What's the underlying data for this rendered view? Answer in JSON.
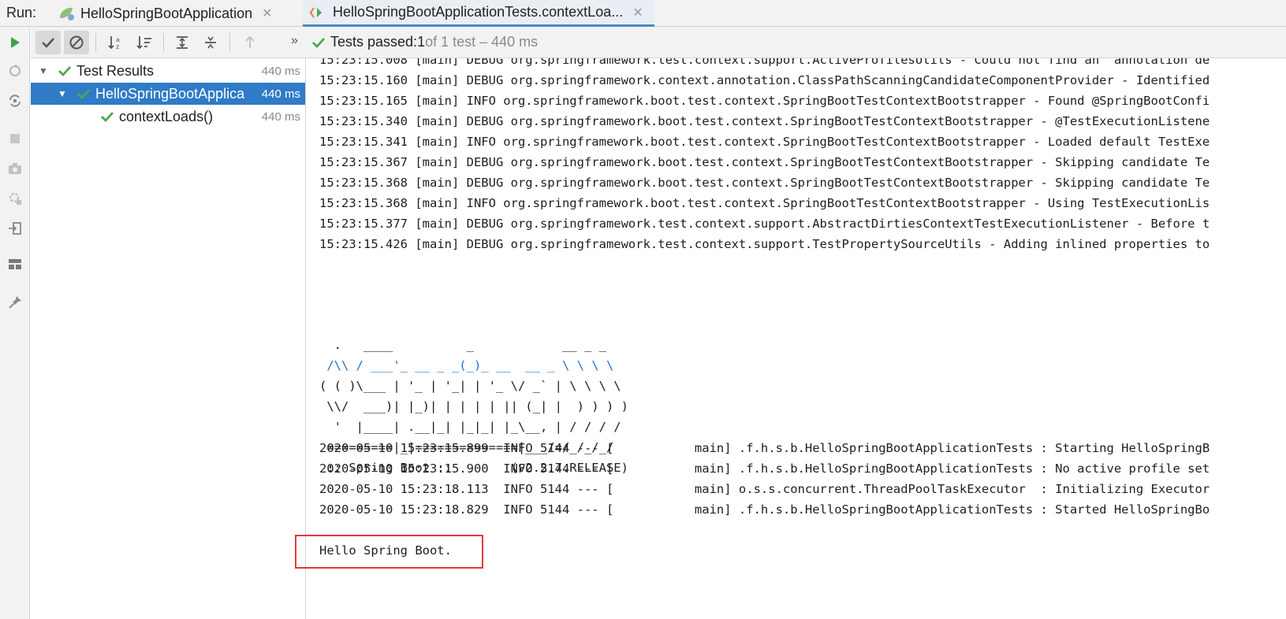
{
  "tabbar": {
    "run_label": "Run:",
    "tabs": [
      {
        "label": "HelloSpringBootApplication",
        "icon": "spring-app-icon"
      },
      {
        "label": "HelloSpringBootApplicationTests.contextLoa...",
        "icon": "test-run-icon"
      }
    ]
  },
  "toolbar": {
    "chevron": "»",
    "status_prefix": "Tests passed: ",
    "status_count": "1",
    "status_suffix": " of 1 test – 440 ms"
  },
  "tree": {
    "rows": [
      {
        "label": "Test Results",
        "duration": "440 ms"
      },
      {
        "label": "HelloSpringBootApplica",
        "duration": "440 ms"
      },
      {
        "label": "contextLoads()",
        "duration": "440 ms"
      }
    ]
  },
  "console": {
    "log_lines": [
      "15:23:15.008 [main] DEBUG org.springframework.test.context.support.ActiveProfilesUtils - Could not find an 'annotation de",
      "15:23:15.160 [main] DEBUG org.springframework.context.annotation.ClassPathScanningCandidateComponentProvider - Identified",
      "15:23:15.165 [main] INFO org.springframework.boot.test.context.SpringBootTestContextBootstrapper - Found @SpringBootConfi",
      "15:23:15.340 [main] DEBUG org.springframework.boot.test.context.SpringBootTestContextBootstrapper - @TestExecutionListene",
      "15:23:15.341 [main] INFO org.springframework.boot.test.context.SpringBootTestContextBootstrapper - Loaded default TestExe",
      "15:23:15.367 [main] DEBUG org.springframework.boot.test.context.SpringBootTestContextBootstrapper - Skipping candidate Te",
      "15:23:15.368 [main] DEBUG org.springframework.boot.test.context.SpringBootTestContextBootstrapper - Skipping candidate Te",
      "15:23:15.368 [main] INFO org.springframework.boot.test.context.SpringBootTestContextBootstrapper - Using TestExecutionLis",
      "15:23:15.377 [main] DEBUG org.springframework.test.context.support.AbstractDirtiesContextTestExecutionListener - Before t",
      "15:23:15.426 [main] DEBUG org.springframework.test.context.support.TestPropertySourceUtils - Adding inlined properties to"
    ],
    "banner": [
      "  .   ____          _            __ _ _",
      " /\\\\ / ___'_ __ _ _(_)_ __  __ _ \\ \\ \\ \\",
      "( ( )\\___ | '_ | '_| | '_ \\/ _` | \\ \\ \\ \\",
      " \\\\/  ___)| |_)| | | | | || (_| |  ) ) ) )",
      "  '  |____| .__|_| |_|_| |_\\__, | / / / /",
      " =========|_|==============|___/=/_/_/_/",
      " :: Spring Boot ::        (v2.2.7.RELEASE)"
    ],
    "boot_lines": [
      "2020-05-10 15:23:15.899  INFO 5144 --- [           main] .f.h.s.b.HelloSpringBootApplicationTests : Starting HelloSpringB",
      "2020-05-10 15:23:15.900  INFO 5144 --- [           main] .f.h.s.b.HelloSpringBootApplicationTests : No active profile set",
      "2020-05-10 15:23:18.113  INFO 5144 --- [           main] o.s.s.concurrent.ThreadPoolTaskExecutor  : Initializing Executor",
      "2020-05-10 15:23:18.829  INFO 5144 --- [           main] .f.h.s.b.HelloSpringBootApplicationTests : Started HelloSpringBo"
    ],
    "hello": "Hello Spring Boot."
  },
  "colors": {
    "pass_green": "#4aa94a",
    "selection_blue": "#2f7bc6",
    "highlight_red": "#e03a3a",
    "banner_link_blue": "#2a6fc6"
  }
}
